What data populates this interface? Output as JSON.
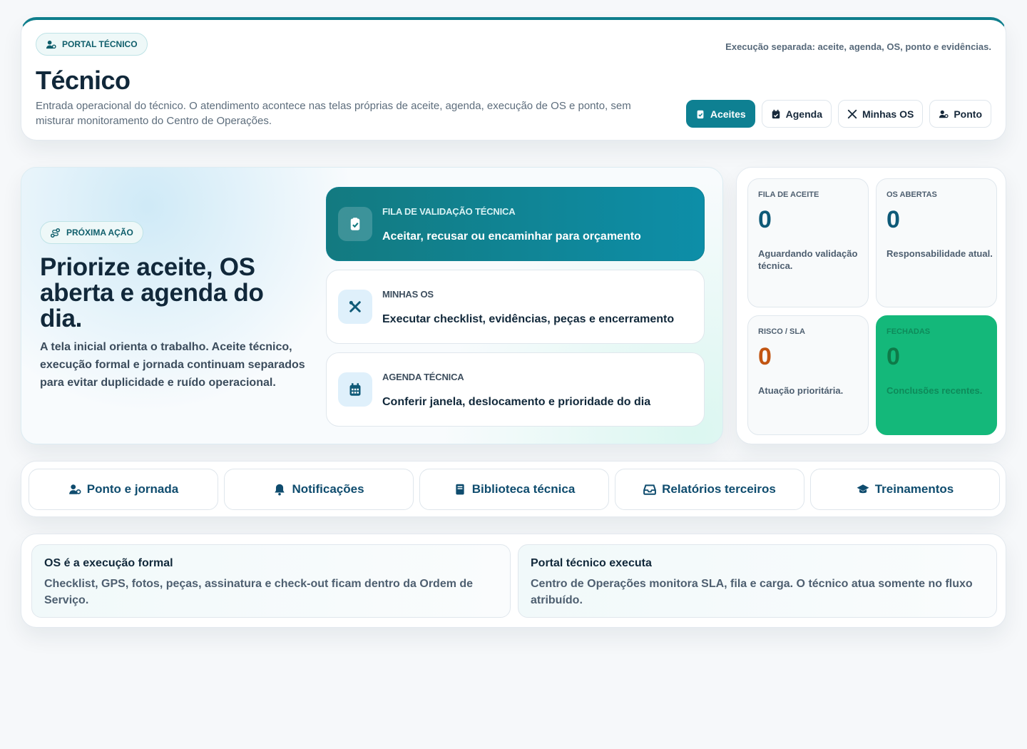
{
  "header": {
    "pill_label": "PORTAL TÉCNICO",
    "note": "Execução separada: aceite, agenda, OS, ponto e evidências.",
    "title": "Técnico",
    "subtitle": "Entrada operacional do técnico. O atendimento acontece nas telas próprias de aceite, agenda, execução de OS e ponto, sem misturar monitoramento do Centro de Operações.",
    "tabs": [
      {
        "label": "Aceites",
        "icon": "clipboard-check-icon",
        "active": true
      },
      {
        "label": "Agenda",
        "icon": "calendar-check-icon",
        "active": false
      },
      {
        "label": "Minhas OS",
        "icon": "tools-icon",
        "active": false
      },
      {
        "label": "Ponto",
        "icon": "user-clock-icon",
        "active": false
      }
    ]
  },
  "hero": {
    "pill_label": "PRÓXIMA AÇÃO",
    "title": "Priorize aceite, OS aberta e agenda do dia.",
    "description": "A tela inicial orienta o trabalho. Aceite técnico, execução formal e jornada continuam separados para evitar duplicidade e ruído operacional.",
    "actions": [
      {
        "kicker": "FILA DE VALIDAÇÃO TÉCNICA",
        "headline": "Aceitar, recusar ou encaminhar para orçamento",
        "icon": "clipboard-check-icon"
      },
      {
        "kicker": "MINHAS OS",
        "headline": "Executar checklist, evidências, peças e encerramento",
        "icon": "tools-icon"
      },
      {
        "kicker": "AGENDA TÉCNICA",
        "headline": "Conferir janela, deslocamento e prioridade do dia",
        "icon": "calendar-icon"
      }
    ]
  },
  "stats": [
    {
      "label": "FILA DE ACEITE",
      "value": "0",
      "note": "Aguardando validação técnica."
    },
    {
      "label": "OS ABERTAS",
      "value": "0",
      "note": "Responsabilidade atual."
    },
    {
      "label": "RISCO / SLA",
      "value": "0",
      "note": "Atuação prioritária."
    },
    {
      "label": "FECHADAS",
      "value": "0",
      "note": "Conclusões recentes."
    }
  ],
  "quick_links": [
    {
      "label": "Ponto e jornada",
      "icon": "user-clock-icon"
    },
    {
      "label": "Notificações",
      "icon": "bell-icon"
    },
    {
      "label": "Biblioteca técnica",
      "icon": "book-icon"
    },
    {
      "label": "Relatórios terceiros",
      "icon": "inbox-icon"
    },
    {
      "label": "Treinamentos",
      "icon": "graduation-cap-icon"
    }
  ],
  "info": [
    {
      "title": "OS é a execução formal",
      "text": "Checklist, GPS, fotos, peças, assinatura e check-out ficam dentro da Ordem de Serviço."
    },
    {
      "title": "Portal técnico executa",
      "text": "Centro de Operações monitora SLA, fila e carga. O técnico atua somente no fluxo atribuído."
    }
  ],
  "colors": {
    "accent": "#0e8092",
    "primary_text": "#11283a",
    "risk": "#c25512",
    "closed_bg": "#14b87a"
  }
}
